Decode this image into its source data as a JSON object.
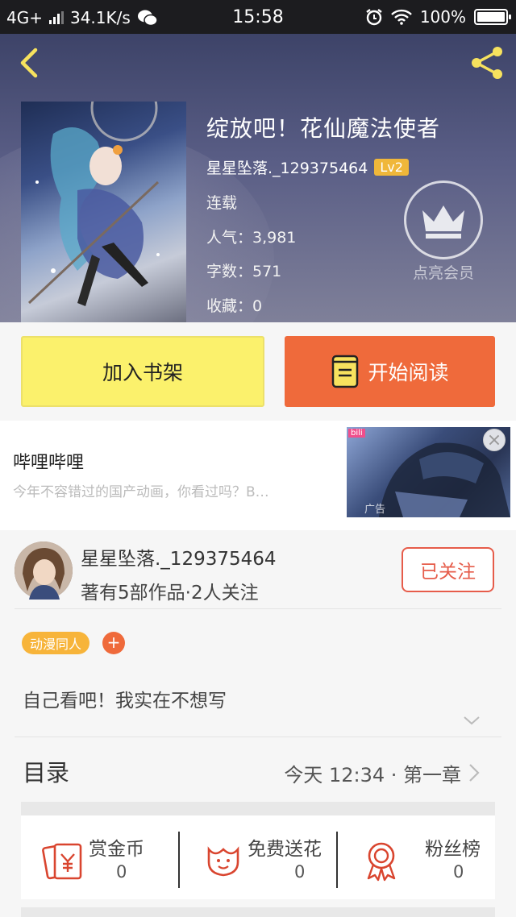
{
  "status_bar": {
    "network": "4G+",
    "speed": "34.1K/s",
    "time": "15:58",
    "battery": "100%"
  },
  "book": {
    "title": "绽放吧！花仙魔法使者",
    "author": "星星坠落._129375464",
    "level": "Lv2",
    "status": "连载",
    "popularity": "人气：3,981",
    "word_count": "字数：571",
    "favorites": "收藏：0"
  },
  "vip": {
    "label": "点亮会员"
  },
  "actions": {
    "add_shelf": "加入书架",
    "start_read": "开始阅读"
  },
  "ad": {
    "title": "哔哩哔哩",
    "subtitle": "今年不容错过的国产动画，你看过吗？B…",
    "tag": "广告"
  },
  "author_card": {
    "name": "星星坠落._129375464",
    "stats": "著有5部作品·2人关注",
    "follow": "已关注"
  },
  "tags": [
    {
      "label": "动漫同人"
    }
  ],
  "add_tag": "+",
  "description": "自己看吧！我实在不想写",
  "toc": {
    "header": "目录",
    "latest": "今天 12:34 · 第一章"
  },
  "rewards": [
    {
      "label": "赏金币",
      "value": "0",
      "icon": "coin-envelope-icon"
    },
    {
      "label": "免费送花",
      "value": "0",
      "icon": "flower-icon"
    },
    {
      "label": "粉丝榜",
      "value": "0",
      "icon": "ribbon-medal-icon"
    }
  ],
  "colors": {
    "accent_orange": "#ef6a3b",
    "shelf_yellow": "#fbf16c",
    "follow_red": "#e65c4a",
    "tag_orange": "#f7b43a",
    "level_gold": "#f0b73a",
    "icon_yellow": "#f7e25e"
  }
}
